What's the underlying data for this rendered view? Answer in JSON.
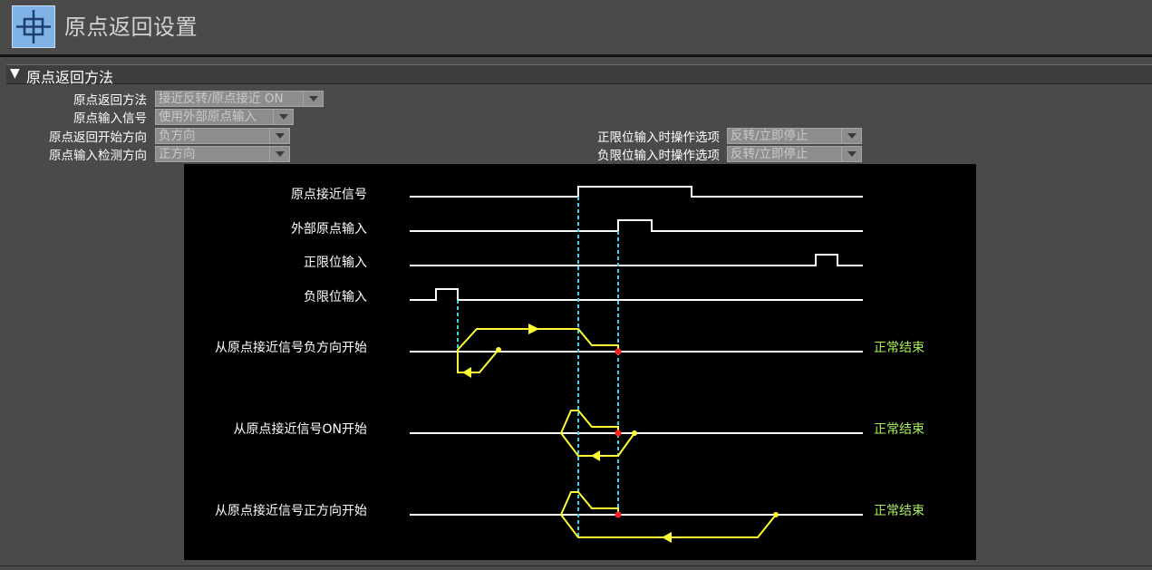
{
  "header": {
    "title": "原点返回设置",
    "icon": "origin-crosshair-icon",
    "icon_color": "#7fb2e6"
  },
  "section": {
    "title": "原点返回方法",
    "expanded": true
  },
  "settings": {
    "method_label": "原点返回方法",
    "method_value": "接近反转/原点接近 ON",
    "input_signal_label": "原点输入信号",
    "input_signal_value": "使用外部原点输入",
    "start_direction_label": "原点返回开始方向",
    "start_direction_value": "负方向",
    "detect_direction_label": "原点输入检测方向",
    "detect_direction_value": "正方向",
    "pos_limit_label": "正限位输入时操作选项",
    "pos_limit_value": "反转/立即停止",
    "neg_limit_label": "负限位输入时操作选项",
    "neg_limit_value": "反转/立即停止"
  },
  "diagram": {
    "signals": [
      "原点接近信号",
      "外部原点输入",
      "正限位输入",
      "负限位输入"
    ],
    "cases": [
      "从原点接近信号负方向开始",
      "从原点接近信号ON开始",
      "从原点接近信号正方向开始"
    ],
    "end_label": "正常结束",
    "colors": {
      "signal": "#ffffff",
      "path": "#ffff33",
      "guide": "#33d6f0",
      "stop_dot": "#ff2020",
      "end_text": "#a8f05a"
    }
  }
}
